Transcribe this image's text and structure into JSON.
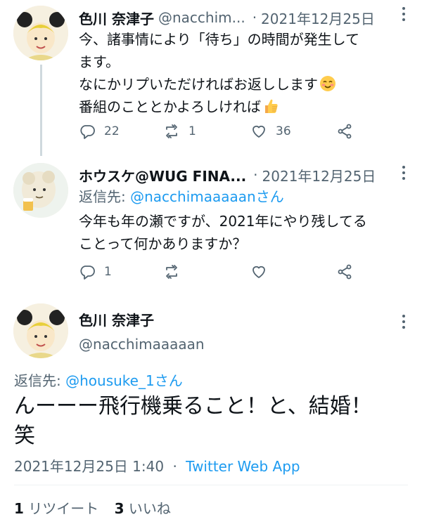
{
  "tweet1": {
    "name": "色川 奈津子",
    "handle": "@nacchim...",
    "dot": "·",
    "date": "2021年12月25日",
    "lines": [
      "今、諸事情により「待ち」の時間が発生しています。",
      "なにかリプいただければお返しします",
      "番組のこととかよろしければ"
    ],
    "line1a": "今、諸事情により「待ち」の時間が発生して",
    "line1b": "ます。",
    "line2": "なにかリプいただければお返しします",
    "line3": "番組のこととかよろしければ",
    "emoji2": "smiling-face-emoji",
    "emoji3": "thumbs-up-emoji",
    "replies": "22",
    "retweets": "1",
    "likes": "36"
  },
  "tweet2": {
    "name": "ホウスケ@WUG FINA...",
    "dot": "·",
    "date": "2021年12月25日",
    "reply_label": "返信先: ",
    "reply_handle": "@nacchimaaaaan",
    "reply_suffix": "さん",
    "line1": "今年も年の瀬ですが、2021年にやり残してる",
    "line2": "ことって何かありますか？",
    "replies": "1",
    "retweets": "",
    "likes": ""
  },
  "main": {
    "name": "色川 奈津子",
    "handle": "@nacchimaaaaan",
    "reply_label": "返信先: ",
    "reply_handle": "@housuke_1",
    "reply_suffix": "さん",
    "line1": "んーーー飛行機乗ること！と、結婚！",
    "line2": "笑",
    "timestamp": "2021年12月25日 1:40",
    "dot": "·",
    "source": "Twitter Web App",
    "retweet_count": "1",
    "retweet_label": "リツイート",
    "like_count": "3",
    "like_label": "いいね"
  },
  "icons": [
    "reply-icon",
    "retweet-icon",
    "like-icon",
    "share-icon",
    "more-icon"
  ],
  "colors": {
    "link": "#1d9bf0",
    "secondary": "#536471",
    "text": "#0f1419",
    "thread": "#cfd9de"
  }
}
